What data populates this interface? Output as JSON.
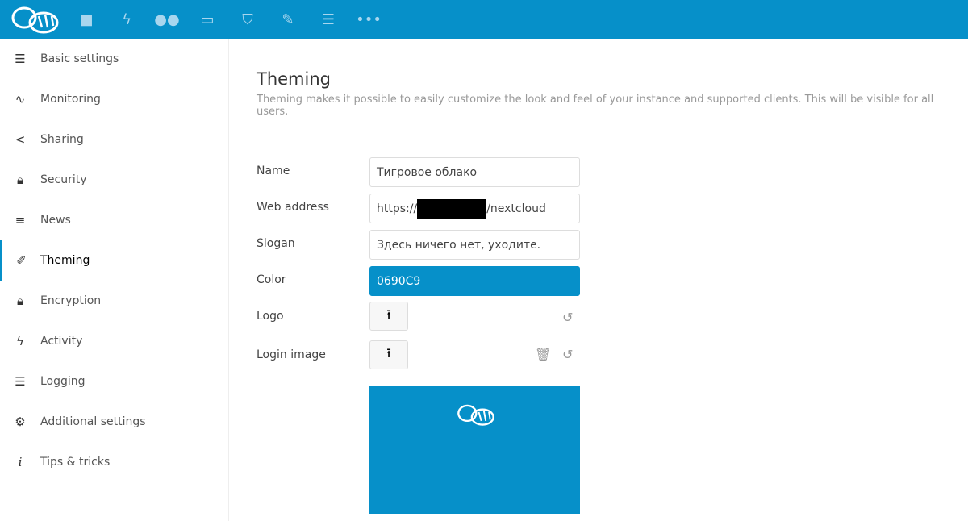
{
  "header": {
    "brand_color": "#0690c9",
    "apps": [
      "files-icon",
      "activity-icon",
      "contacts-icon",
      "calendar-icon",
      "passwords-icon",
      "notes-icon",
      "deck-icon",
      "more-icon"
    ]
  },
  "sidebar": {
    "items": [
      {
        "label": "Basic settings",
        "icon": "list-icon"
      },
      {
        "label": "Monitoring",
        "icon": "pulse-icon"
      },
      {
        "label": "Sharing",
        "icon": "share-icon"
      },
      {
        "label": "Security",
        "icon": "lock-icon"
      },
      {
        "label": "News",
        "icon": "news-icon"
      },
      {
        "label": "Theming",
        "icon": "brush-icon",
        "active": true
      },
      {
        "label": "Encryption",
        "icon": "lock-icon"
      },
      {
        "label": "Activity",
        "icon": "bolt-icon"
      },
      {
        "label": "Logging",
        "icon": "list-icon"
      },
      {
        "label": "Additional settings",
        "icon": "gear-icon"
      },
      {
        "label": "Tips & tricks",
        "icon": "info-icon"
      }
    ]
  },
  "main": {
    "title": "Theming",
    "description": "Theming makes it possible to easily customize the look and feel of your instance and supported clients. This will be visible for all users.",
    "labels": {
      "name": "Name",
      "url": "Web address",
      "slogan": "Slogan",
      "color": "Color",
      "logo": "Logo",
      "login_image": "Login image"
    },
    "values": {
      "name": "Тигровое облако",
      "url_prefix": "https://",
      "url_suffix": "/nextcloud",
      "slogan": "Здесь ничего нет, уходите.",
      "color": "0690C9"
    }
  }
}
